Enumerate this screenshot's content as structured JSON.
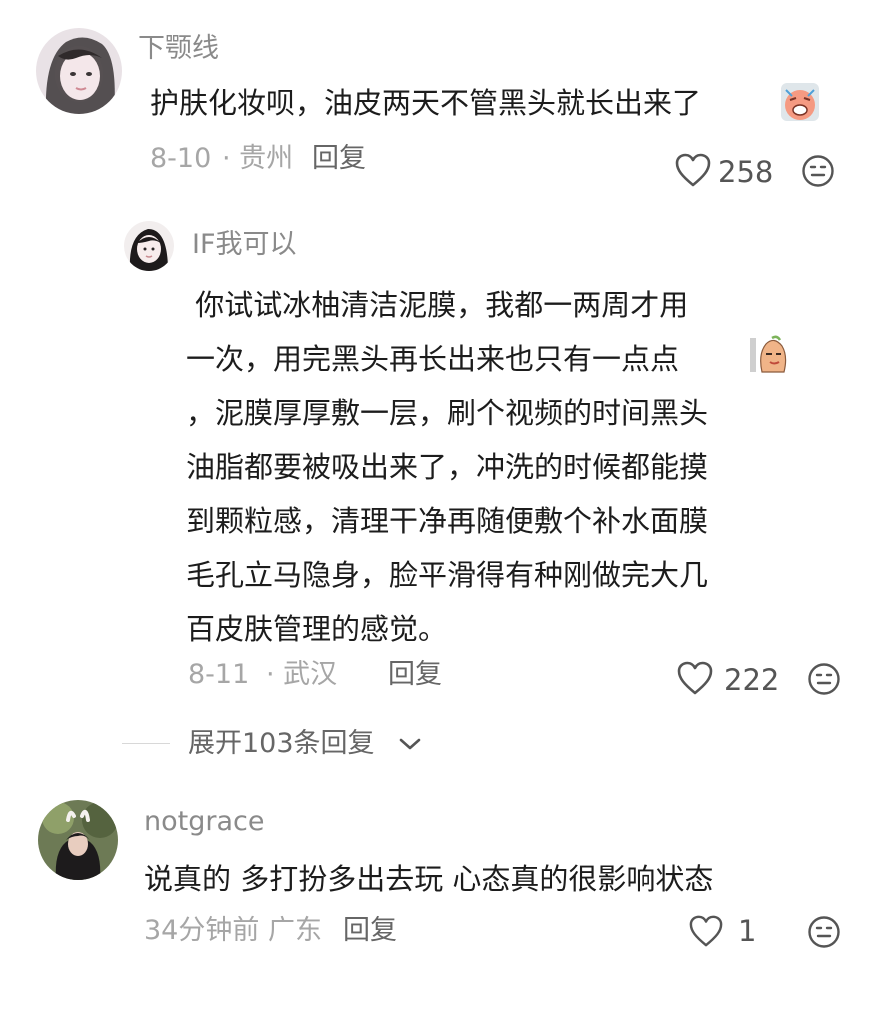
{
  "comments": [
    {
      "username": "下颚线",
      "text": "护肤化妆呗，油皮两天不管黑头就长出来了",
      "date": "8-10",
      "location": "· 贵州",
      "reply_label": "回复",
      "likes": "258"
    }
  ],
  "reply": {
    "username": "IF我可以",
    "lines": [
      " 你试试冰柚清洁泥膜，我都一两周才用",
      "一次，用完黑头再长出来也只有一点点",
      "，泥膜厚厚敷一层，刷个视频的时间黑头",
      "油脂都要被吸出来了，冲洗的时候都能摸",
      "到颗粒感，清理干净再随便敷个补水面膜",
      "毛孔立马隐身，脸平滑得有种刚做完大几",
      "百皮肤管理的感觉。"
    ],
    "date": "8-11",
    "location": "· 武汉",
    "reply_label": "回复",
    "likes": "222"
  },
  "expand": {
    "label": "展开103条回复"
  },
  "comment2": {
    "username": "notgrace",
    "text": "说真的 多打扮多出去玩 心态真的很影响状态",
    "date_location": "34分钟前 广东",
    "reply_label": "回复",
    "likes": "1"
  },
  "colors": {
    "text": "#1c1c1c",
    "username": "#8a8a8a",
    "meta": "#a6a6a6",
    "icon": "#555555"
  },
  "icons": {
    "like": "heart-outline-icon",
    "dislike": "neutral-face-icon",
    "expand": "chevron-down-icon"
  }
}
